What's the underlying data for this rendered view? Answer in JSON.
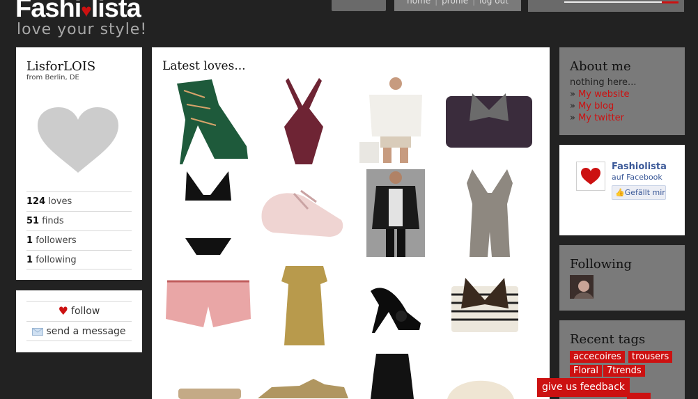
{
  "header": {
    "logo_before": "Fashi",
    "logo_after": "lista",
    "tagline": "love your style!",
    "nav": [
      "home",
      "profile",
      "log out"
    ]
  },
  "profile": {
    "name": "LisforLOIS",
    "location": "from Berlin, DE",
    "stats": [
      {
        "count": "124",
        "label": "loves"
      },
      {
        "count": "51",
        "label": "finds"
      },
      {
        "count": "1",
        "label": "followers"
      },
      {
        "count": "1",
        "label": "following"
      }
    ],
    "actions": {
      "follow": "follow",
      "message": "send a message"
    }
  },
  "center": {
    "title": "Latest loves..."
  },
  "about": {
    "title": "About me",
    "text": "nothing here...",
    "links": [
      "My website",
      "My blog",
      "My twitter"
    ]
  },
  "facebook": {
    "name": "Fashiolista",
    "sub": "auf Facebook",
    "like": "Gefällt mir"
  },
  "following": {
    "title": "Following"
  },
  "tags": {
    "title": "Recent tags",
    "items": [
      "accecoires",
      "trousers",
      "Floral",
      "7trends"
    ]
  },
  "feedback": "give us feedback",
  "colors": {
    "accent": "#cc1111",
    "background": "#222222",
    "panel_gray": "#7a7a7a"
  }
}
